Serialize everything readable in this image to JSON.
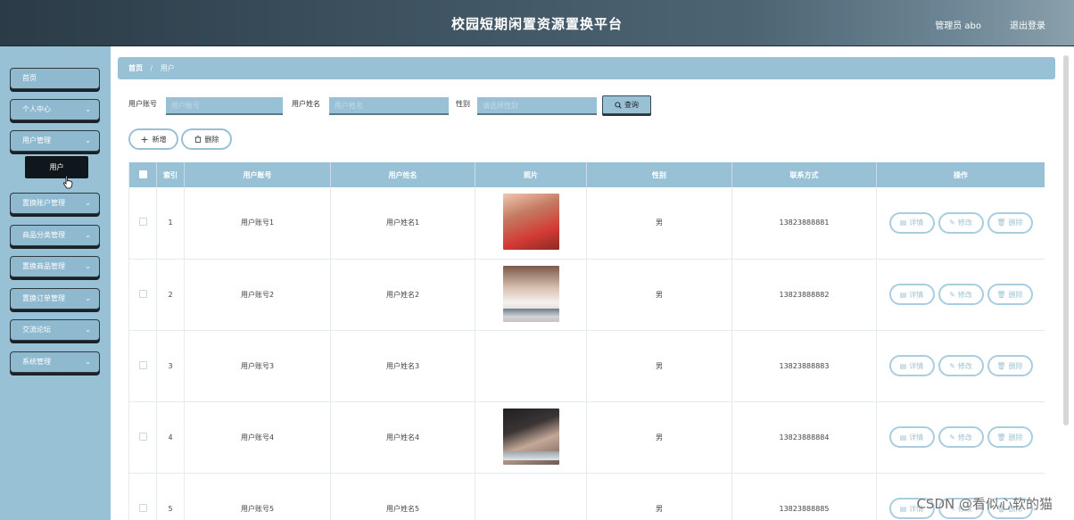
{
  "header": {
    "title": "校园短期闲置资源置换平台",
    "admin": "管理员 abo",
    "logout": "退出登录"
  },
  "sidebar": {
    "items": [
      {
        "label": "首页",
        "chevron": false
      },
      {
        "label": "个人中心",
        "chevron": true
      },
      {
        "label": "用户管理",
        "chevron": true
      },
      {
        "label": "置换账户管理",
        "chevron": true
      },
      {
        "label": "商品分类管理",
        "chevron": true
      },
      {
        "label": "置换商品管理",
        "chevron": true
      },
      {
        "label": "置换订单管理",
        "chevron": true
      },
      {
        "label": "交流论坛",
        "chevron": true
      },
      {
        "label": "系统管理",
        "chevron": true
      }
    ],
    "submenu": "用户"
  },
  "breadcrumb": {
    "home": "首页",
    "sep": "/",
    "current": "用户"
  },
  "search": {
    "account_label": "用户账号",
    "account_placeholder": "用户账号",
    "name_label": "用户姓名",
    "name_placeholder": "用户姓名",
    "gender_label": "性别",
    "gender_placeholder": "请选择性别",
    "query": "查询"
  },
  "actions": {
    "add": "新增",
    "delete": "删除"
  },
  "table": {
    "headers": [
      "",
      "索引",
      "用户账号",
      "用户姓名",
      "照片",
      "性别",
      "联系方式",
      "操作"
    ],
    "rows": [
      {
        "index": "1",
        "account": "用户账号1",
        "name": "用户姓名1",
        "gender": "男",
        "phone": "13823888881"
      },
      {
        "index": "2",
        "account": "用户账号2",
        "name": "用户姓名2",
        "gender": "男",
        "phone": "13823888882"
      },
      {
        "index": "3",
        "account": "用户账号3",
        "name": "用户姓名3",
        "gender": "男",
        "phone": "13823888883"
      },
      {
        "index": "4",
        "account": "用户账号4",
        "name": "用户姓名4",
        "gender": "男",
        "phone": "13823888884"
      },
      {
        "index": "5",
        "account": "用户账号5",
        "name": "用户姓名5",
        "gender": "男",
        "phone": "13823888885"
      }
    ],
    "row_actions": {
      "detail": "详情",
      "edit": "修改",
      "delete": "删除"
    }
  },
  "watermark": "CSDN @看似心软的猫",
  "colors": {
    "accent": "#98c1d6",
    "header_dark": "#2b3b47"
  }
}
